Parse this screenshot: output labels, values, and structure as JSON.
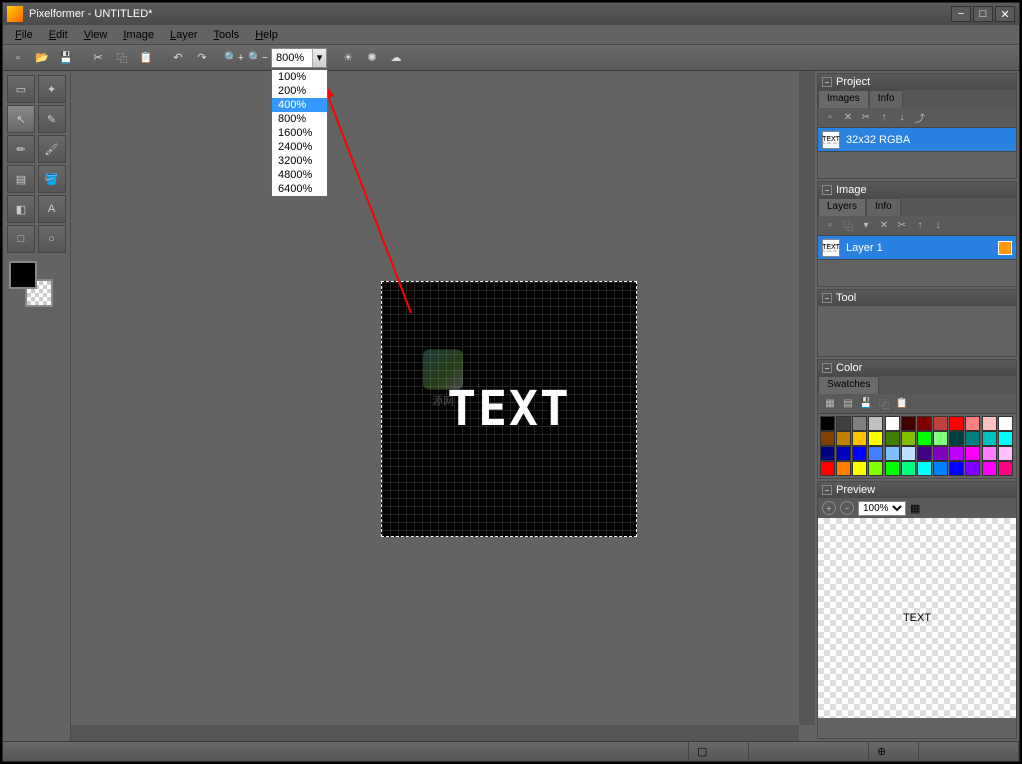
{
  "app": {
    "title": "Pixelformer - UNTITLED*"
  },
  "menu": {
    "file": "File",
    "edit": "Edit",
    "view": "View",
    "image": "Image",
    "layer": "Layer",
    "tools": "Tools",
    "help": "Help"
  },
  "toolbar": {
    "zoom_value": "800%",
    "zoom_options": [
      "100%",
      "200%",
      "400%",
      "800%",
      "1600%",
      "2400%",
      "3200%",
      "4800%",
      "6400%"
    ],
    "zoom_selected": "400%"
  },
  "canvas": {
    "text": "TEXT",
    "watermark": "源网"
  },
  "panels": {
    "project": {
      "title": "Project",
      "tabs": {
        "images": "Images",
        "info": "Info"
      },
      "item_label": "32x32 RGBA",
      "thumb_text": "TEXT"
    },
    "image": {
      "title": "Image",
      "tabs": {
        "layers": "Layers",
        "info": "Info"
      },
      "layer_label": "Layer 1",
      "thumb_text": "TEXT"
    },
    "tool": {
      "title": "Tool"
    },
    "color": {
      "title": "Color",
      "tab": "Swatches",
      "swatches": [
        "#000000",
        "#404040",
        "#808080",
        "#c0c0c0",
        "#ffffff",
        "#400000",
        "#800000",
        "#c04040",
        "#ff0000",
        "#ff8080",
        "#ffc0c0",
        "#ffffff",
        "#804000",
        "#c08000",
        "#ffc000",
        "#ffff00",
        "#408000",
        "#80c000",
        "#00ff00",
        "#80ff80",
        "#004040",
        "#008080",
        "#00c0c0",
        "#00ffff",
        "#000080",
        "#0000c0",
        "#0000ff",
        "#4080ff",
        "#80c0ff",
        "#c0e0ff",
        "#400080",
        "#8000c0",
        "#c000ff",
        "#ff00ff",
        "#ff80ff",
        "#ffc0ff",
        "#ff0000",
        "#ff8000",
        "#ffff00",
        "#80ff00",
        "#00ff00",
        "#00ff80",
        "#00ffff",
        "#0080ff",
        "#0000ff",
        "#8000ff",
        "#ff00ff",
        "#ff0080"
      ]
    },
    "preview": {
      "title": "Preview",
      "zoom": "100%",
      "text": "TEXT"
    }
  }
}
